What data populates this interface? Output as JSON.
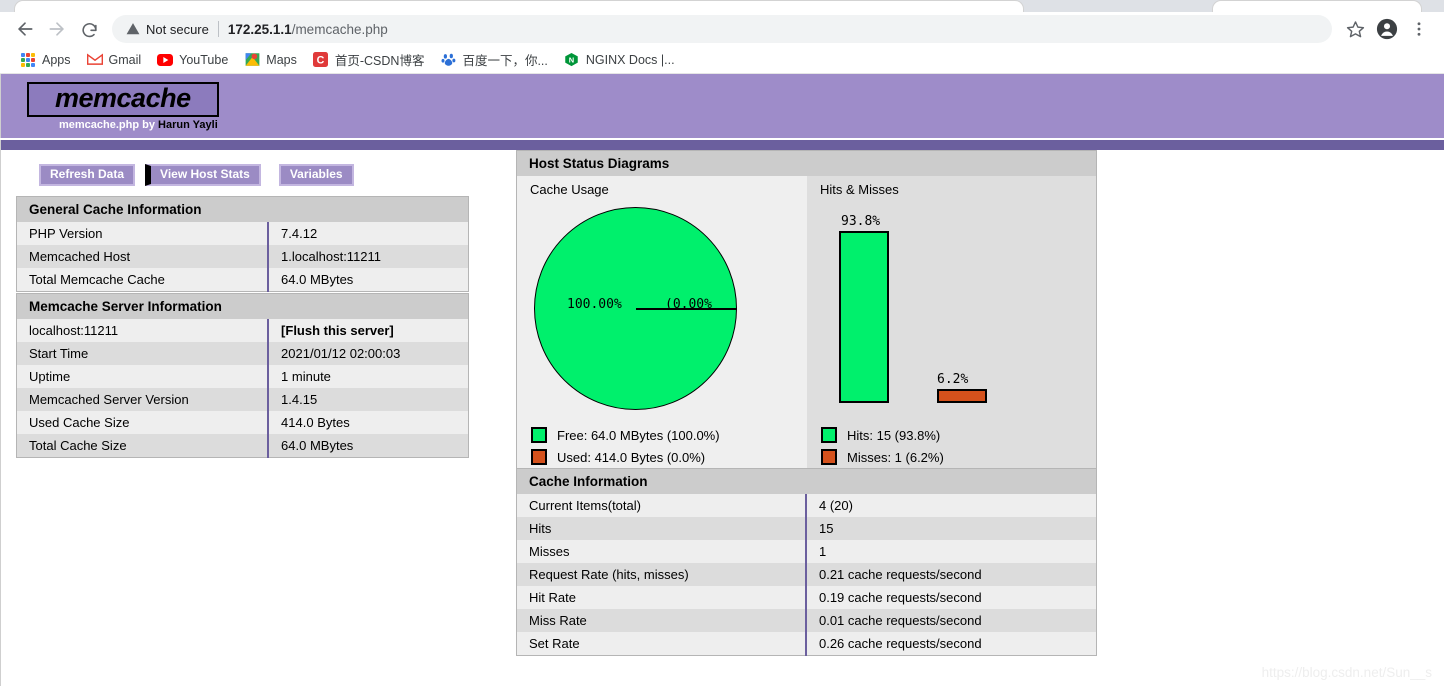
{
  "browser": {
    "security_label": "Not secure",
    "url_host": "172.25.1.1",
    "url_path": "/memcache.php",
    "back_icon": "back-arrow-icon",
    "forward_icon": "forward-arrow-icon",
    "reload_icon": "reload-icon",
    "warning_icon": "warning-triangle-icon",
    "star_icon": "bookmark-star-icon",
    "profile_icon": "profile-avatar-icon",
    "menu_icon": "three-dot-menu-icon",
    "bookmarks": [
      {
        "label": "Apps",
        "icon": "apps-grid-icon"
      },
      {
        "label": "Gmail",
        "icon": "gmail-icon"
      },
      {
        "label": "YouTube",
        "icon": "youtube-icon"
      },
      {
        "label": "Maps",
        "icon": "maps-icon"
      },
      {
        "label": "首页-CSDN博客",
        "icon": "csdn-icon"
      },
      {
        "label": "百度一下，你...",
        "icon": "baidu-icon"
      },
      {
        "label": "NGINX Docs |...",
        "icon": "nginx-icon"
      }
    ]
  },
  "header": {
    "logo": "memcache",
    "byline_lead": "memcache.php by",
    "byline_name": "Harun Yayli"
  },
  "toolbar": {
    "refresh_label": "Refresh Data",
    "host_stats_label": "View Host Stats",
    "variables_label": "Variables"
  },
  "general_cache": {
    "title": "General Cache Information",
    "rows": [
      {
        "label": "PHP Version",
        "value": "7.4.12"
      },
      {
        "label": "Memcached Host",
        "value": "1.localhost:11211"
      },
      {
        "label": "Total Memcache Cache",
        "value": "64.0 MBytes"
      }
    ]
  },
  "server_info": {
    "title": "Memcache Server Information",
    "rows": [
      {
        "label": "localhost:11211",
        "value": "[Flush this server]",
        "bold": true
      },
      {
        "label": "Start Time",
        "value": "2021/01/12 02:00:03"
      },
      {
        "label": "Uptime",
        "value": "1 minute"
      },
      {
        "label": "Memcached Server Version",
        "value": "1.4.15"
      },
      {
        "label": "Used Cache Size",
        "value": "414.0 Bytes"
      },
      {
        "label": "Total Cache Size",
        "value": "64.0 MBytes"
      }
    ]
  },
  "diagrams": {
    "title": "Host Status Diagrams",
    "cache_usage_title": "Cache Usage",
    "hits_misses_title": "Hits & Misses",
    "pie_free_label": "100.00%",
    "pie_used_label": "(0.00%",
    "bar_hits_label": "93.8%",
    "bar_misses_label": "6.2%",
    "legend_cache": [
      {
        "label": "Free: 64.0 MBytes (100.0%)",
        "color": "#00f06c"
      },
      {
        "label": "Used: 414.0 Bytes (0.0%)",
        "color": "#d4511c"
      }
    ],
    "legend_hits": [
      {
        "label": "Hits: 15 (93.8%)",
        "color": "#00f06c"
      },
      {
        "label": "Misses: 1 (6.2%)",
        "color": "#d4511c"
      }
    ]
  },
  "cache_information": {
    "title": "Cache Information",
    "rows": [
      {
        "label": "Current Items(total)",
        "value": "4 (20)"
      },
      {
        "label": "Hits",
        "value": "15"
      },
      {
        "label": "Misses",
        "value": "1"
      },
      {
        "label": "Request Rate (hits, misses)",
        "value": "0.21 cache requests/second"
      },
      {
        "label": "Hit Rate",
        "value": "0.19 cache requests/second"
      },
      {
        "label": "Miss Rate",
        "value": "0.01 cache requests/second"
      },
      {
        "label": "Set Rate",
        "value": "0.26 cache requests/second"
      }
    ]
  },
  "watermark": "https://blog.csdn.net/Sun__s",
  "chart_data": [
    {
      "type": "pie",
      "title": "Cache Usage",
      "categories": [
        "Free",
        "Used"
      ],
      "values": [
        100.0,
        0.0
      ],
      "labels": [
        "100.00%",
        "(0.00%"
      ],
      "legend": [
        "Free: 64.0 MBytes (100.0%)",
        "Used: 414.0 Bytes (0.0%)"
      ],
      "colors": [
        "#00f06c",
        "#d4511c"
      ],
      "legend_position": "bottom"
    },
    {
      "type": "bar",
      "title": "Hits & Misses",
      "categories": [
        "Hits",
        "Misses"
      ],
      "values": [
        93.8,
        6.2
      ],
      "ylabel": "",
      "xlabel": "",
      "ylim": [
        0,
        100
      ],
      "grid": false,
      "data_labels": [
        "93.8%",
        "6.2%"
      ],
      "legend": [
        "Hits: 15 (93.8%)",
        "Misses: 1 (6.2%)"
      ],
      "colors": [
        "#00f06c",
        "#d4511c"
      ],
      "legend_position": "bottom"
    }
  ]
}
